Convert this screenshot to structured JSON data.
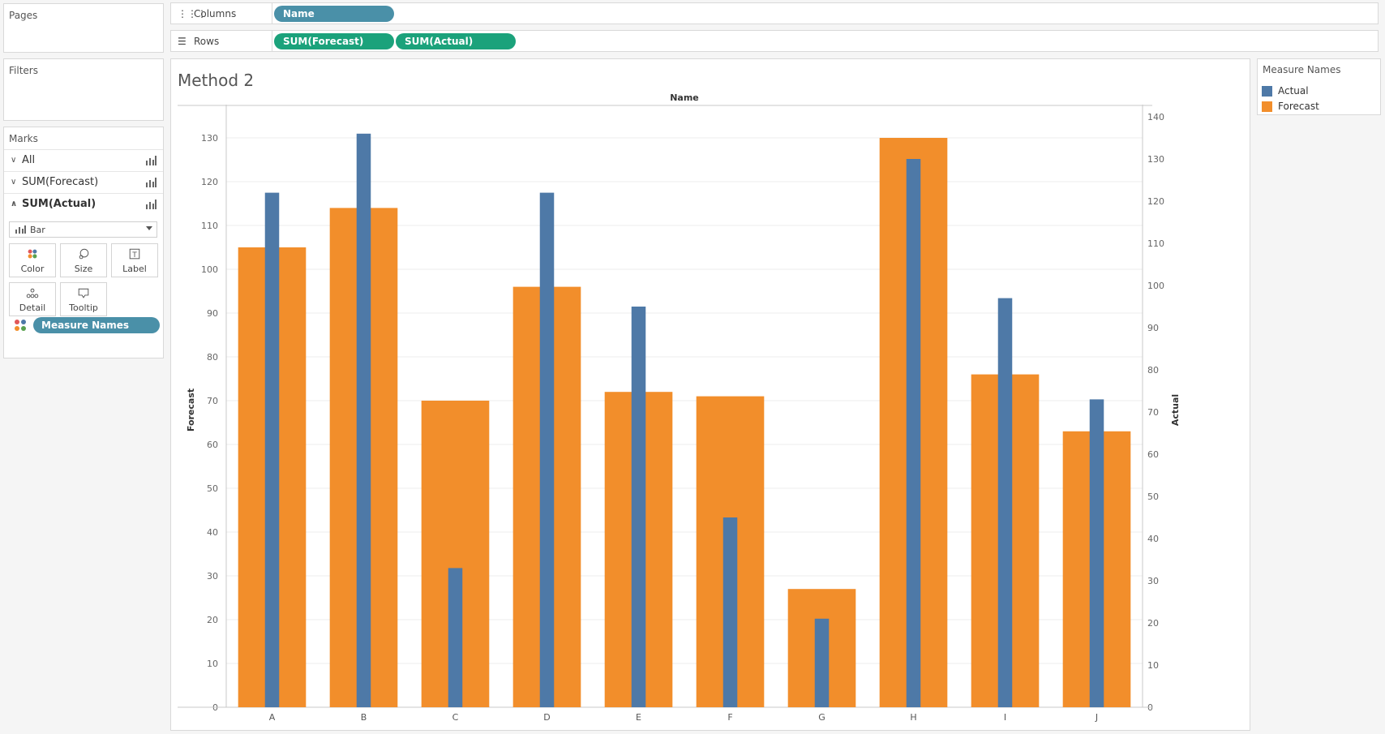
{
  "cards": {
    "pages": "Pages",
    "filters": "Filters",
    "marks": "Marks",
    "legend": "Measure Names"
  },
  "shelves": {
    "columns": {
      "label": "Columns",
      "pills": [
        "Name"
      ]
    },
    "rows": {
      "label": "Rows",
      "pills": [
        "SUM(Forecast)",
        "SUM(Actual)"
      ]
    }
  },
  "marks": {
    "tabs": [
      "All",
      "SUM(Forecast)",
      "SUM(Actual)"
    ],
    "active_tab": "SUM(Actual)",
    "mark_type": "Bar",
    "buttons": [
      "Color",
      "Size",
      "Label",
      "Detail",
      "Tooltip"
    ],
    "color_pill": "Measure Names"
  },
  "legend": {
    "items": [
      {
        "name": "Actual",
        "color": "#4e79a7"
      },
      {
        "name": "Forecast",
        "color": "#f28e2b"
      }
    ]
  },
  "viz": {
    "title": "Method 2"
  },
  "colors": {
    "accent_blue_pill": "#4a90a8",
    "accent_green_pill": "#1ba27b",
    "actual": "#4e79a7",
    "forecast": "#f28e2b"
  },
  "chart_data": {
    "type": "bar",
    "title": "Method 2",
    "top_header": "Name",
    "categories": [
      "A",
      "B",
      "C",
      "D",
      "E",
      "F",
      "G",
      "H",
      "I",
      "J"
    ],
    "series": [
      {
        "name": "Forecast",
        "axis": "left",
        "values": [
          105,
          114,
          70,
          96,
          72,
          71,
          27,
          130,
          76,
          63
        ]
      },
      {
        "name": "Actual",
        "axis": "right",
        "values": [
          122,
          136,
          33,
          122,
          95,
          45,
          21,
          130,
          97,
          73
        ]
      }
    ],
    "ylabel_left": "Forecast",
    "ylabel_right": "Actual",
    "ylim_left": [
      0,
      130
    ],
    "ylim_right": [
      0,
      140
    ],
    "yticks_left": [
      0,
      10,
      20,
      30,
      40,
      50,
      60,
      70,
      80,
      90,
      100,
      110,
      120,
      130
    ],
    "yticks_right": [
      0,
      10,
      20,
      30,
      40,
      50,
      60,
      70,
      80,
      90,
      100,
      110,
      120,
      130,
      140
    ],
    "grid": true,
    "legend": "top-right"
  }
}
